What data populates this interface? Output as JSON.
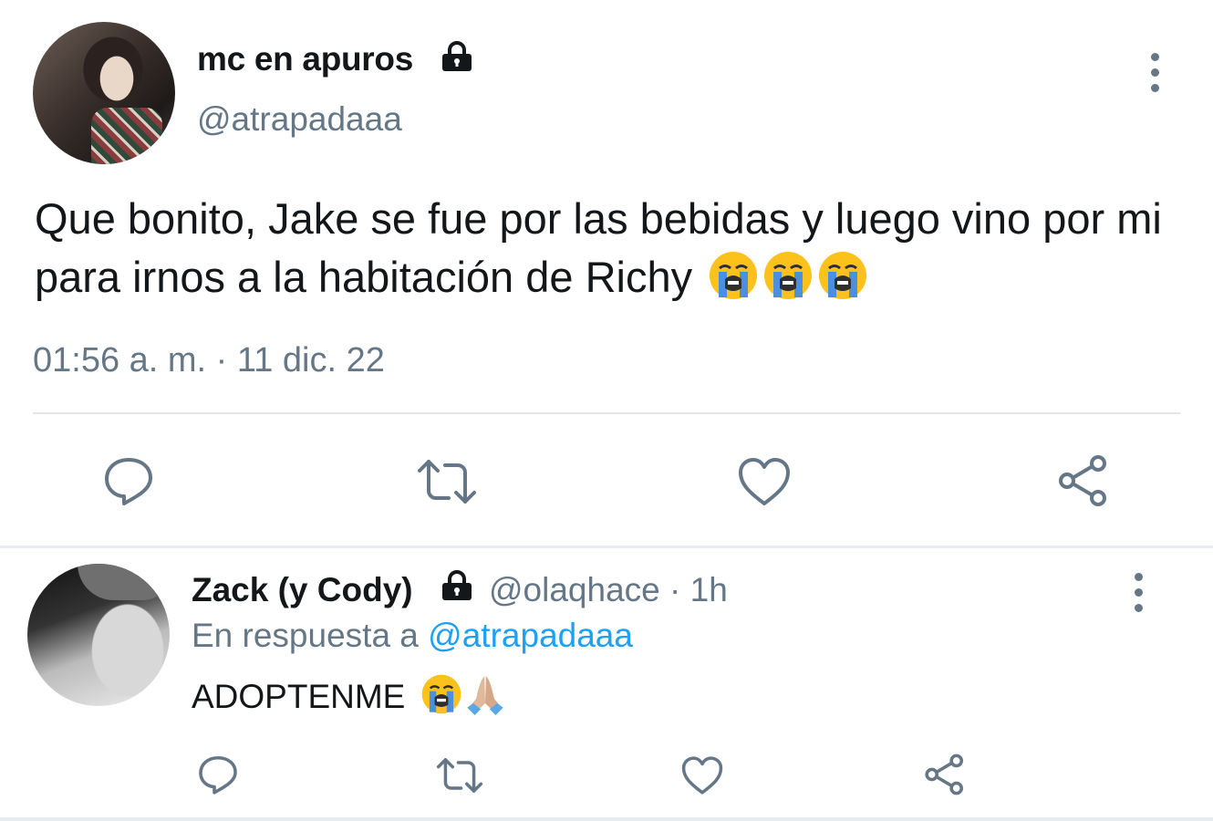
{
  "tweet": {
    "author_name": "mc en apuros",
    "author_handle": "@atrapadaaa",
    "text": "Que bonito, Jake se fue por las bebidas y luego vino por mi para irnos a la habitación de Richy",
    "emojis": [
      "loudly-crying-face",
      "loudly-crying-face",
      "loudly-crying-face"
    ],
    "timestamp": "01:56 a. m. · 11 dic. 22",
    "locked": true,
    "actions": [
      "reply-icon",
      "retweet-icon",
      "like-icon",
      "share-icon"
    ]
  },
  "reply": {
    "author_name": "Zack (y Cody)",
    "author_handle": "@olaqhace · 1h",
    "reply_prefix": "En respuesta a ",
    "reply_to": "@atrapadaaa",
    "text": "ADOPTENME",
    "emojis": [
      "loudly-crying-face",
      "folded-hands"
    ],
    "locked": true,
    "actions": [
      "reply-icon",
      "retweet-icon",
      "like-icon",
      "share-icon"
    ]
  },
  "colors": {
    "text": "#14171a",
    "secondary": "#657786",
    "link": "#1da1f2",
    "divider": "#e1e8ed"
  }
}
